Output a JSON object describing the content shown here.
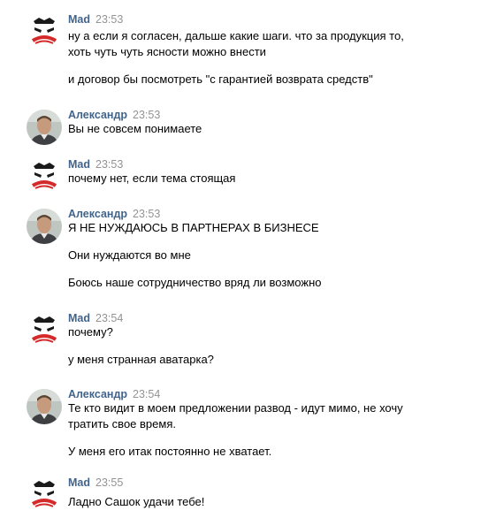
{
  "messages": [
    {
      "author": "Mad",
      "time": "23:53",
      "avatar": "mad-face-icon",
      "lines": [
        "ну а если я согласен, дальше какие шаги. что за продукция то,",
        "хоть чуть чуть ясности можно внести",
        "и договор бы посмотреть \"с гарантией возврата средств\""
      ]
    },
    {
      "author": "Александр",
      "time": "23:53",
      "avatar": "user-photo",
      "lines": [
        "Вы не совсем понимаете"
      ]
    },
    {
      "author": "Mad",
      "time": "23:53",
      "avatar": "mad-face-icon",
      "lines": [
        "почему нет, если тема стоящая"
      ]
    },
    {
      "author": "Александр",
      "time": "23:53",
      "avatar": "user-photo",
      "lines": [
        "Я НЕ НУЖДАЮСЬ В ПАРТНЕРАХ В БИЗНЕСЕ",
        "Они нуждаются во мне",
        "Боюсь наше сотрудничество вряд ли возможно"
      ]
    },
    {
      "author": "Mad",
      "time": "23:54",
      "avatar": "mad-face-icon",
      "lines": [
        "почему?",
        "у меня странная аватарка?"
      ]
    },
    {
      "author": "Александр",
      "time": "23:54",
      "avatar": "user-photo",
      "lines": [
        "Те кто видит в моем предложении развод - идут мимо, не хочу",
        "тратить свое время.",
        "У меня его итак постоянно не хватает."
      ]
    },
    {
      "author": "Mad",
      "time": "23:55",
      "avatar": "mad-face-icon",
      "lines": [
        "Ладно Сашок удачи тебе!"
      ]
    }
  ],
  "colors": {
    "author": "#42648b",
    "time": "#939393",
    "text": "#000000",
    "mad_avatar_red": "#d42a2a"
  }
}
